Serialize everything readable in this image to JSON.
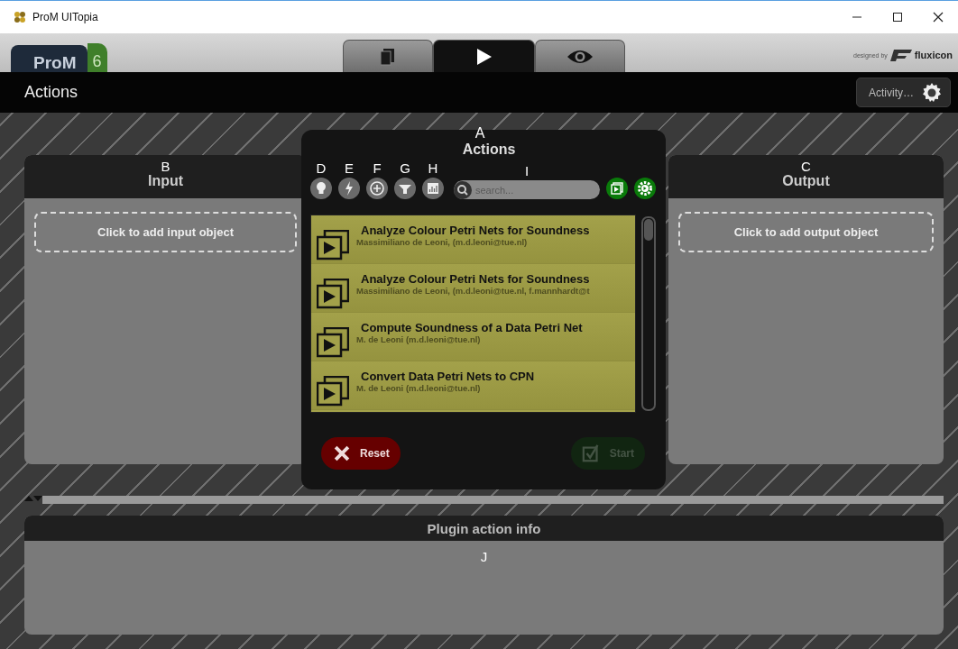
{
  "window": {
    "title": "ProM UITopia"
  },
  "header": {
    "logo": "ProM",
    "logo_version": "6",
    "credit": "designed by",
    "brand": "fluxicon",
    "tabs": [
      {
        "kind": "documents",
        "selected": false
      },
      {
        "kind": "play",
        "selected": true
      },
      {
        "kind": "eye",
        "selected": false
      }
    ]
  },
  "toolbar": {
    "title": "Actions",
    "activity_button": "Activity…"
  },
  "input_panel": {
    "marker": "B",
    "title": "Input",
    "add_button": "Click to add input object"
  },
  "output_panel": {
    "marker": "C",
    "title": "Output",
    "add_button": "Click to add output object"
  },
  "dialog": {
    "marker": "A",
    "title": "Actions",
    "filters": [
      {
        "marker": "D",
        "kind": "bulb"
      },
      {
        "marker": "E",
        "kind": "bolt"
      },
      {
        "marker": "F",
        "kind": "plus"
      },
      {
        "marker": "G",
        "kind": "funnel"
      },
      {
        "marker": "H",
        "kind": "chart"
      }
    ],
    "search": {
      "marker": "I",
      "placeholder": "search..."
    },
    "actions": [
      {
        "title": "Analyze Colour Petri Nets for Soundness",
        "author": "Massimiliano de Leoni, (m.d.leoni@tue.nl)"
      },
      {
        "title": "Analyze Colour Petri Nets for Soundness",
        "author": "Massimiliano de Leoni, (m.d.leoni@tue.nl, f.mannhardt@t"
      },
      {
        "title": "Compute Soundness of a Data Petri Net",
        "author": "M. de Leoni (m.d.leoni@tue.nl)"
      },
      {
        "title": "Convert Data Petri Nets to CPN",
        "author": "M. de Leoni (m.d.leoni@tue.nl)"
      }
    ],
    "reset_button": {
      "label": "Reset",
      "disabled": false
    },
    "start_button": {
      "label": "Start",
      "disabled": true
    }
  },
  "info_panel": {
    "title": "Plugin action info",
    "marker": "J"
  }
}
